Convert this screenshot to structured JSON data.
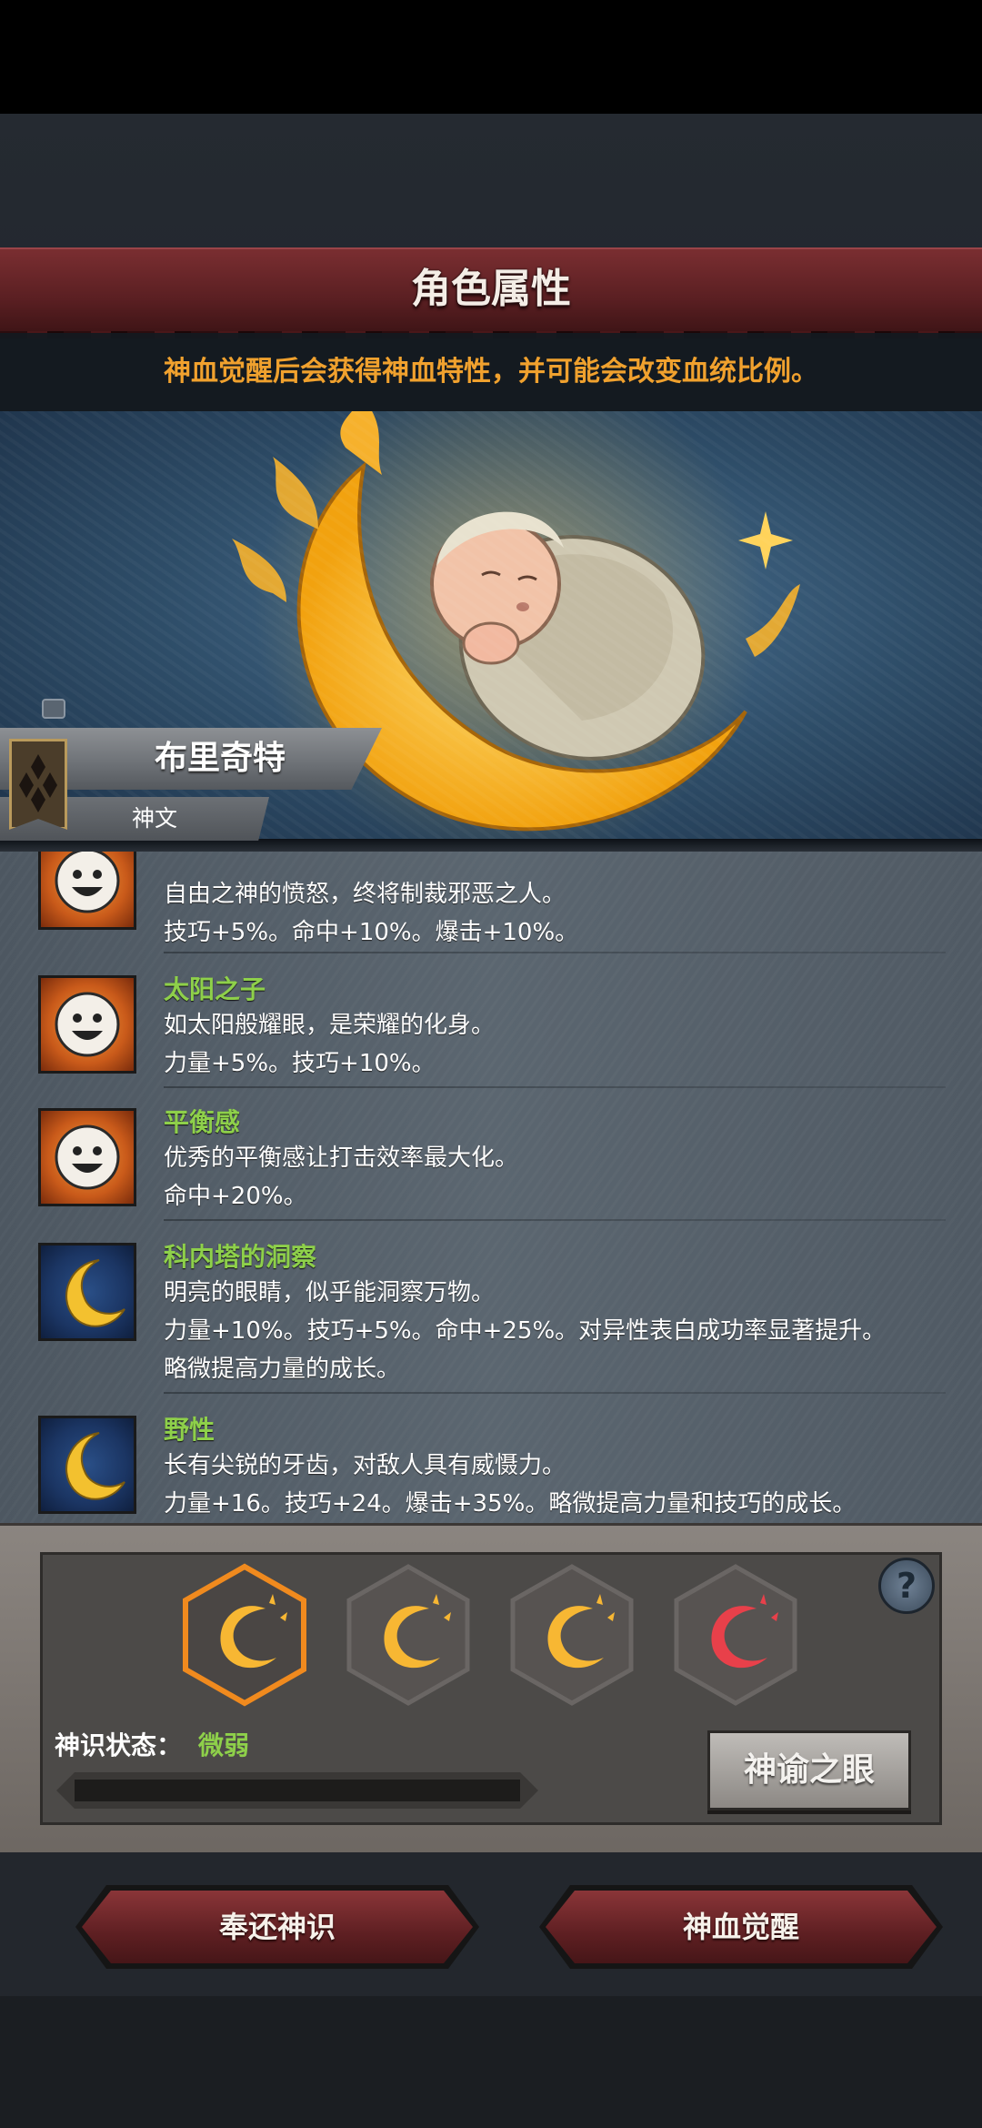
{
  "header": {
    "title": "角色属性",
    "subtitle": "神血觉醒后会获得神血特性，并可能会改变血统比例。"
  },
  "character": {
    "name": "布里奇特",
    "tag": "神文"
  },
  "traits": [
    {
      "name": "",
      "icon": "smiley-icon",
      "desc": "自由之神的愤怒，终将制裁邪恶之人。",
      "stats": [
        "技巧+5%。命中+10%。爆击+10%。"
      ]
    },
    {
      "name": "太阳之子",
      "icon": "smiley-icon",
      "desc": "如太阳般耀眼，是荣耀的化身。",
      "stats": [
        "力量+5%。技巧+10%。"
      ]
    },
    {
      "name": "平衡感",
      "icon": "smiley-icon",
      "desc": "优秀的平衡感让打击效率最大化。",
      "stats": [
        "命中+20%。"
      ]
    },
    {
      "name": "科内塔的洞察",
      "icon": "moon-icon",
      "desc": "明亮的眼睛，似乎能洞察万物。",
      "stats": [
        "力量+10%。技巧+5%。命中+25%。对异性表白成功率显著提升。",
        "略微提高力量的成长。"
      ]
    },
    {
      "name": "野性",
      "icon": "moon-icon",
      "desc": "长有尖锐的牙齿，对敌人具有威慑力。",
      "stats": [
        "力量+16。技巧+24。爆击+35%。略微提高力量和技巧的成长。"
      ]
    }
  ],
  "divine": {
    "status_label": "神识状态：",
    "status_value": "微弱",
    "progress": 0.0,
    "oracle_button": "神谕之眼",
    "help": "?",
    "slots": [
      {
        "color": "#f7b733",
        "selected": true
      },
      {
        "color": "#f7b733",
        "selected": false
      },
      {
        "color": "#f7b733",
        "selected": false
      },
      {
        "color": "#e8404a",
        "selected": false
      }
    ]
  },
  "actions": {
    "return_button": "奉还神识",
    "awaken_button": "神血觉醒"
  },
  "colors": {
    "accent_orange": "#f0a12e",
    "trait_green": "#8ed04a",
    "banner_red": "#6a2528"
  }
}
